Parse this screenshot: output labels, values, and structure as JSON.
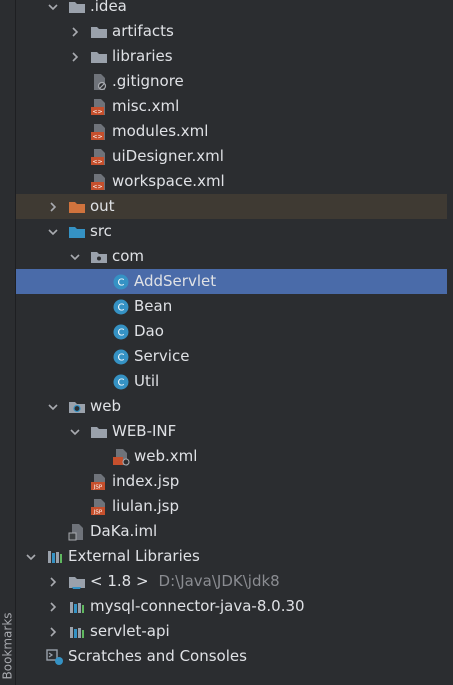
{
  "sidebar": {
    "bookmarks_label": "Bookmarks"
  },
  "tree": {
    "idea": ".idea",
    "artifacts": "artifacts",
    "libraries": "libraries",
    "gitignore": ".gitignore",
    "misc": "misc.xml",
    "modules": "modules.xml",
    "uidesigner": "uiDesigner.xml",
    "workspace": "workspace.xml",
    "out": "out",
    "src": "src",
    "com": "com",
    "addservlet": "AddServlet",
    "bean": "Bean",
    "dao": "Dao",
    "service": "Service",
    "util": "Util",
    "web": "web",
    "webinf": "WEB-INF",
    "webxml": "web.xml",
    "indexjsp": "index.jsp",
    "liulanjsp": "liulan.jsp",
    "dakaiml": "DaKa.iml",
    "external_libraries": "External Libraries",
    "jdk": "< 1.8 >",
    "jdk_path": "D:\\Java\\JDK\\jdk8",
    "mysql": "mysql-connector-java-8.0.30",
    "servletapi": "servlet-api",
    "scratches": "Scratches and Consoles"
  },
  "colors": {
    "selected_row": "#4a6ba9",
    "excluded_row": "#3f3a33",
    "class_icon": "#3592c4",
    "folder_icon": "#9aa1ab",
    "excluded_folder": "#d0733d",
    "xml_icon": "#c6502d"
  }
}
